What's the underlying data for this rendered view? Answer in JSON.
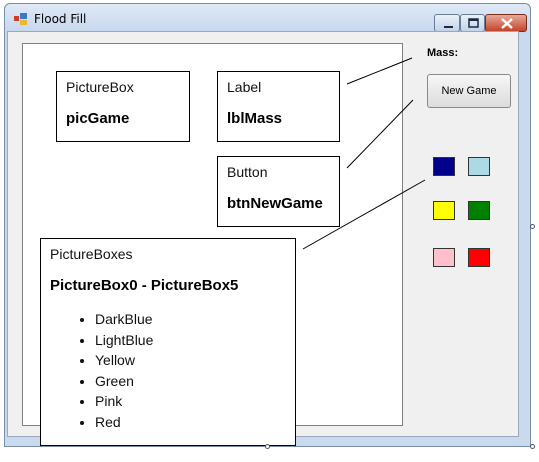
{
  "window": {
    "title": "Flood Fill"
  },
  "right_panel": {
    "mass_label": "Mass:",
    "new_game_label": "New Game",
    "swatches": [
      {
        "name": "DarkBlue",
        "color": "#00008b"
      },
      {
        "name": "LightBlue",
        "color": "#add8e6"
      },
      {
        "name": "Yellow",
        "color": "#ffff00"
      },
      {
        "name": "Green",
        "color": "#008000"
      },
      {
        "name": "Pink",
        "color": "#ffc0cb"
      },
      {
        "name": "Red",
        "color": "#ff0000"
      }
    ]
  },
  "annotations": {
    "picturebox": {
      "type": "PictureBox",
      "name": "picGame"
    },
    "label": {
      "type": "Label",
      "name": "lblMass"
    },
    "button": {
      "type": "Button",
      "name": "btnNewGame"
    },
    "pictureboxes": {
      "type": "PictureBoxes",
      "name": "PictureBox0 - PictureBox5",
      "items": [
        "DarkBlue",
        "LightBlue",
        "Yellow",
        "Green",
        "Pink",
        "Red"
      ]
    }
  }
}
